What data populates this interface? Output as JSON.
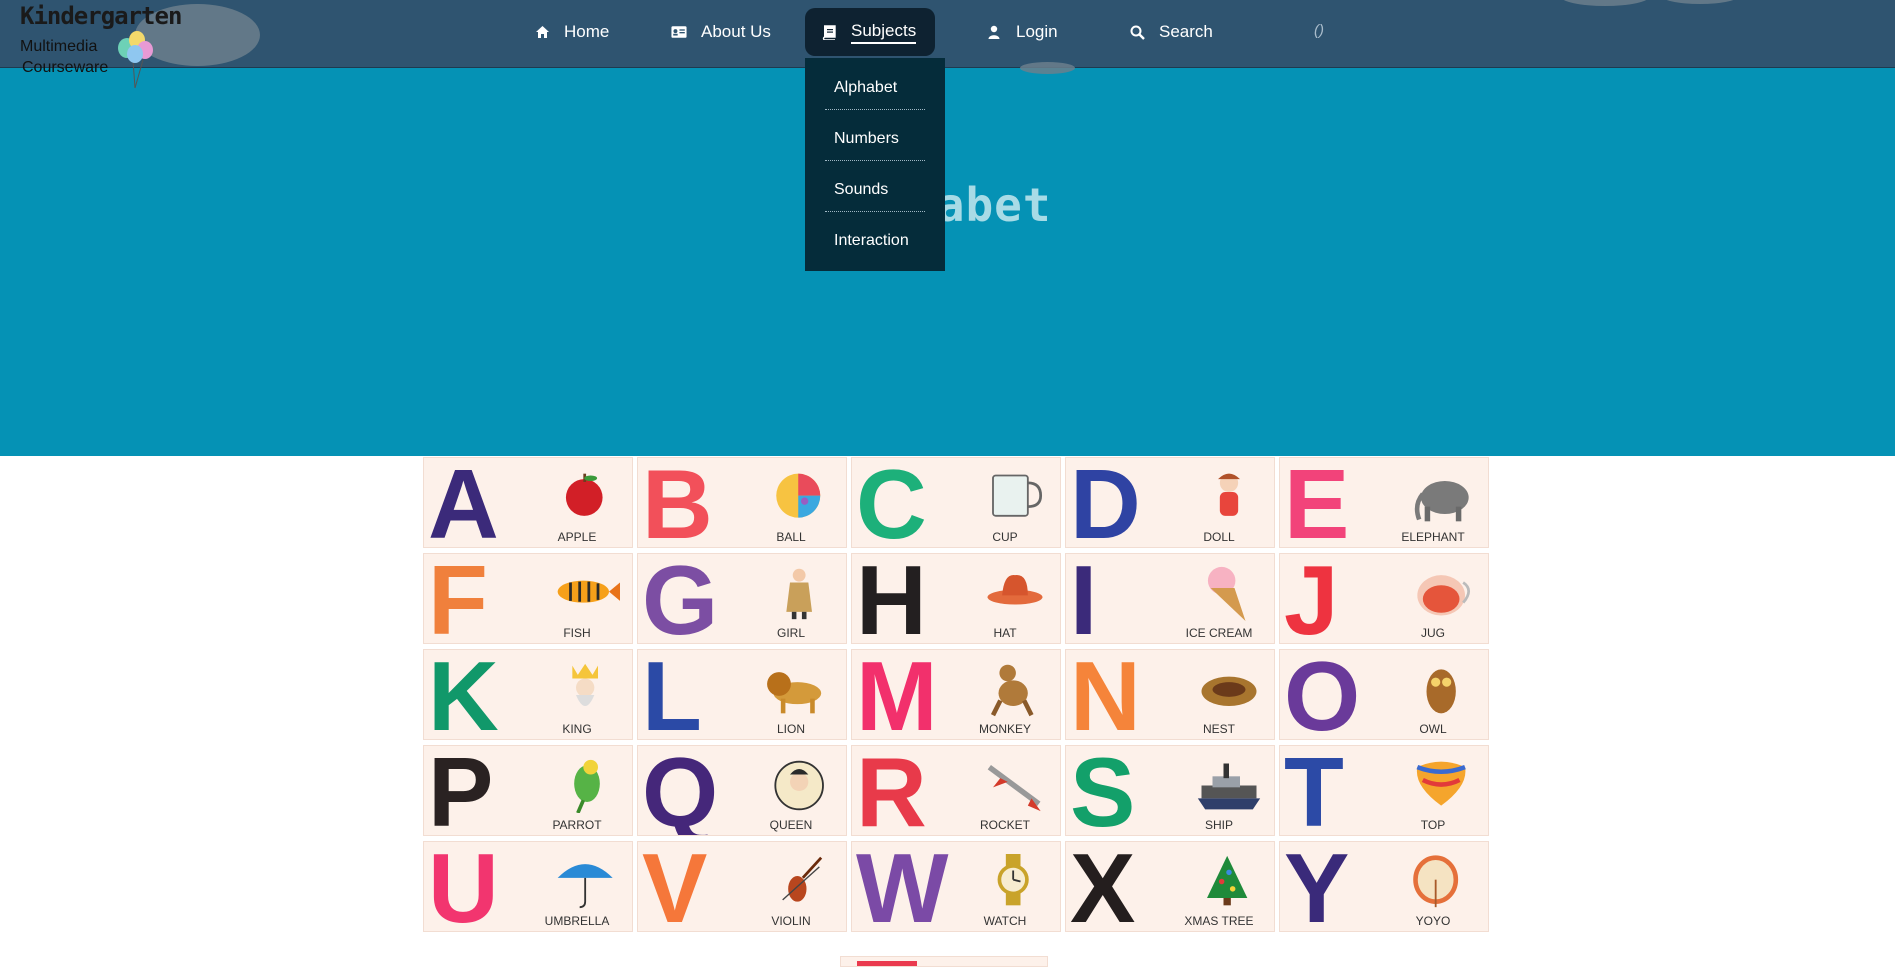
{
  "logo": {
    "title": "Kindergarten",
    "line1": "Multimedia",
    "line2": "Courseware"
  },
  "nav": {
    "home": "Home",
    "about": "About Us",
    "subjects": "Subjects",
    "login": "Login",
    "search": "Search",
    "extra": "()"
  },
  "dropdown": {
    "items": [
      "Alphabet",
      "Numbers",
      "Sounds",
      "Interaction"
    ]
  },
  "hero": {
    "title": "Alphabet"
  },
  "tiles": [
    {
      "letter": "A",
      "word": "APPLE",
      "color": "#3b2a7a"
    },
    {
      "letter": "B",
      "word": "BALL",
      "color": "#f2505a"
    },
    {
      "letter": "C",
      "word": "CUP",
      "color": "#1db07a"
    },
    {
      "letter": "D",
      "word": "DOLL",
      "color": "#2f43a3"
    },
    {
      "letter": "E",
      "word": "ELEPHANT",
      "color": "#f2437a"
    },
    {
      "letter": "F",
      "word": "FISH",
      "color": "#f0803c"
    },
    {
      "letter": "G",
      "word": "GIRL",
      "color": "#7c4ea3"
    },
    {
      "letter": "H",
      "word": "HAT",
      "color": "#231f20"
    },
    {
      "letter": "I",
      "word": "ICE CREAM",
      "color": "#3b2a7a"
    },
    {
      "letter": "J",
      "word": "JUG",
      "color": "#ee3340"
    },
    {
      "letter": "K",
      "word": "KING",
      "color": "#11986a"
    },
    {
      "letter": "L",
      "word": "LION",
      "color": "#2b4aa6"
    },
    {
      "letter": "M",
      "word": "MONKEY",
      "color": "#f2306c"
    },
    {
      "letter": "N",
      "word": "NEST",
      "color": "#f5843a"
    },
    {
      "letter": "O",
      "word": "OWL",
      "color": "#6a3a9a"
    },
    {
      "letter": "P",
      "word": "PARROT",
      "color": "#2a2222"
    },
    {
      "letter": "Q",
      "word": "QUEEN",
      "color": "#45277a"
    },
    {
      "letter": "R",
      "word": "ROCKET",
      "color": "#e83a4a"
    },
    {
      "letter": "S",
      "word": "SHIP",
      "color": "#13a06a"
    },
    {
      "letter": "T",
      "word": "TOP",
      "color": "#2c4aa6"
    },
    {
      "letter": "U",
      "word": "UMBRELLA",
      "color": "#f2356f"
    },
    {
      "letter": "V",
      "word": "VIOLIN",
      "color": "#f5773a"
    },
    {
      "letter": "W",
      "word": "WATCH",
      "color": "#7b4aa6"
    },
    {
      "letter": "X",
      "word": "XMAS TREE",
      "color": "#241e1e"
    },
    {
      "letter": "Y",
      "word": "YOYO",
      "color": "#3a2a7a"
    }
  ],
  "colors": {
    "navbar": "#2f5470",
    "hero": "#0592b5",
    "dropdown": "#052c3a"
  }
}
